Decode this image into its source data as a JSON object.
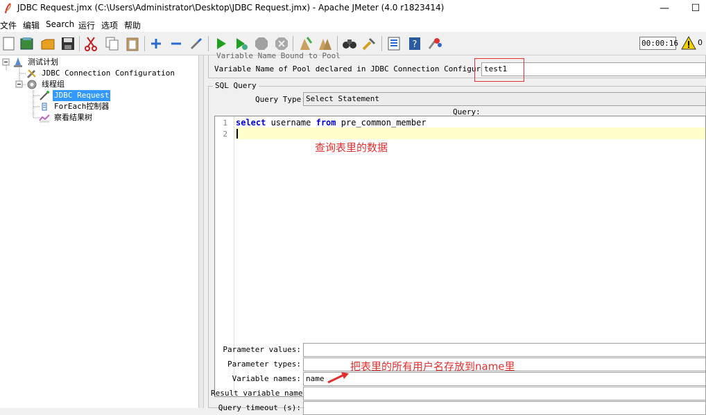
{
  "window": {
    "title": "JDBC Request.jmx (C:\\Users\\Administrator\\Desktop\\JDBC Request.jmx) - Apache JMeter (4.0 r1823414)",
    "minimize": "—",
    "maximize": "☐"
  },
  "menu": [
    "文件",
    "编辑",
    "Search",
    "运行",
    "选项",
    "帮助"
  ],
  "toolbar": {
    "icons": [
      "new-icon",
      "templates-icon",
      "open-icon",
      "save-icon",
      "cut-icon",
      "copy-icon",
      "paste-icon",
      "expand-icon",
      "collapse-icon",
      "toggle-icon",
      "start-icon",
      "start-no-pause-icon",
      "stop-icon",
      "shutdown-icon",
      "clear-icon",
      "clear-all-icon",
      "search-icon",
      "reset-search-icon",
      "function-helper-icon",
      "help-icon",
      "remote-icon"
    ],
    "timer": "00:00:16",
    "warnings": "0"
  },
  "tree": [
    {
      "label": "测试计划",
      "icon": "test-plan-icon"
    },
    {
      "label": "JDBC Connection Configuration",
      "icon": "config-wrench-icon"
    },
    {
      "label": "线程组",
      "icon": "thread-group-gear-icon"
    },
    {
      "label": "JDBC Request",
      "icon": "sampler-pipette-icon",
      "selected": true
    },
    {
      "label": "ForEach控制器",
      "icon": "controller-icon"
    },
    {
      "label": "察看结果树",
      "icon": "listener-chart-icon"
    }
  ],
  "pool": {
    "cut_label": "Variable Name Bound to Pool",
    "label": "Variable Name of Pool declared in JDBC Connection Configuration:",
    "value": "test1"
  },
  "sql": {
    "group_title": "SQL Query",
    "query_type_label": "Query Type:",
    "query_type_value": "Select Statement",
    "query_label": "Query:",
    "line_numbers": [
      "1",
      "2"
    ],
    "code_keyword1": "select",
    "code_mid": " username ",
    "code_keyword2": "from",
    "code_tail": " pre_common_member"
  },
  "params": [
    {
      "label": "Parameter values:",
      "value": ""
    },
    {
      "label": "Parameter types:",
      "value": ""
    },
    {
      "label": "Variable names:",
      "value": "name"
    },
    {
      "label": "Result variable name:",
      "value": ""
    },
    {
      "label": "Query timeout (s):",
      "value": ""
    }
  ],
  "annotations": {
    "query_note": "查询表里的数据",
    "variable_note": "把表里的所有用户名存放到name里",
    "accent": "#e03030"
  }
}
